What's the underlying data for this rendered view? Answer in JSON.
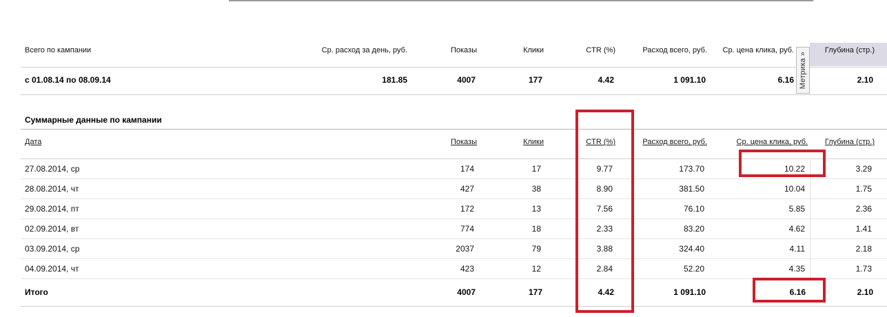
{
  "summary": {
    "headers": {
      "campaign": "Всего по кампании",
      "avg_daily": "Ср. расход за день, руб.",
      "impressions": "Показы",
      "clicks": "Клики",
      "ctr": "CTR (%)",
      "spend": "Расход всего, руб.",
      "cpc": "Ср. цена клика, руб.",
      "depth": "Глубина (стр.)"
    },
    "row": {
      "period": "с 01.08.14 по 08.09.14",
      "avg_daily": "181.85",
      "impressions": "4007",
      "clicks": "177",
      "ctr": "4.42",
      "spend": "1 091.10",
      "cpc": "6.16",
      "depth": "2.10"
    }
  },
  "metrika_tab": {
    "label": "Метрика »"
  },
  "details": {
    "title": "Суммарные данные по кампании",
    "columns": {
      "date": "Дата",
      "impressions": "Показы",
      "clicks": "Клики",
      "ctr": "CTR (%)",
      "spend": "Расход всего, руб.",
      "cpc": "Ср. цена клика, руб.",
      "depth": "Глубина (стр.)"
    },
    "rows": [
      {
        "date": "27.08.2014, ср",
        "impressions": "174",
        "clicks": "17",
        "ctr": "9.77",
        "spend": "173.70",
        "cpc": "10.22",
        "depth": "3.29"
      },
      {
        "date": "28.08.2014, чт",
        "impressions": "427",
        "clicks": "38",
        "ctr": "8.90",
        "spend": "381.50",
        "cpc": "10.04",
        "depth": "1.75"
      },
      {
        "date": "29.08.2014, пт",
        "impressions": "172",
        "clicks": "13",
        "ctr": "7.56",
        "spend": "76.10",
        "cpc": "5.85",
        "depth": "2.36"
      },
      {
        "date": "02.09.2014, вт",
        "impressions": "774",
        "clicks": "18",
        "ctr": "2.33",
        "spend": "83.20",
        "cpc": "4.62",
        "depth": "1.41"
      },
      {
        "date": "03.09.2014, ср",
        "impressions": "2037",
        "clicks": "79",
        "ctr": "3.88",
        "spend": "324.40",
        "cpc": "4.11",
        "depth": "2.18"
      },
      {
        "date": "04.09.2014, чт",
        "impressions": "423",
        "clicks": "12",
        "ctr": "2.84",
        "spend": "52.20",
        "cpc": "4.35",
        "depth": "1.73"
      }
    ],
    "total": {
      "label": "Итого",
      "impressions": "4007",
      "clicks": "177",
      "ctr": "4.42",
      "spend": "1 091.10",
      "cpc": "6.16",
      "depth": "2.10"
    }
  },
  "annotation_color": "#cc2028"
}
